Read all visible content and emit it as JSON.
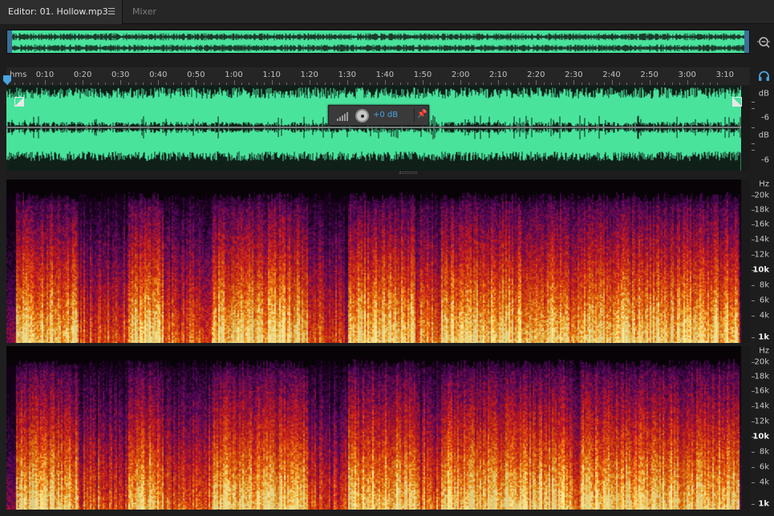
{
  "tabs": {
    "editor_label": "Editor: 01. Hollow.mp3",
    "editor_menu": "☰",
    "mixer_label": "Mixer"
  },
  "timeline": {
    "unit": "hms",
    "labels": [
      "0:10",
      "0:20",
      "0:30",
      "0:40",
      "0:50",
      "1:00",
      "1:10",
      "1:20",
      "1:30",
      "1:40",
      "1:50",
      "2:00",
      "2:10",
      "2:20",
      "2:30",
      "2:40",
      "2:50",
      "3:00",
      "3:10"
    ]
  },
  "waveform": {
    "db_unit": "dB",
    "db_labels": [
      "-6",
      "-6"
    ],
    "hud_value": "+0 dB"
  },
  "spectral": {
    "hz_unit": "Hz",
    "freq_labels": [
      "20k",
      "18k",
      "16k",
      "14k",
      "12k",
      "10k",
      "8k",
      "6k",
      "4k",
      "1k"
    ]
  },
  "colors": {
    "waveform": "#49e39c",
    "accent": "#4aa3df",
    "background": "#1d1d1d"
  },
  "icons": {
    "zoom": "zoom-to-fit-icon",
    "headphone": "headphone-icon",
    "pin": "pin-icon",
    "meter": "level-meter-icon"
  }
}
